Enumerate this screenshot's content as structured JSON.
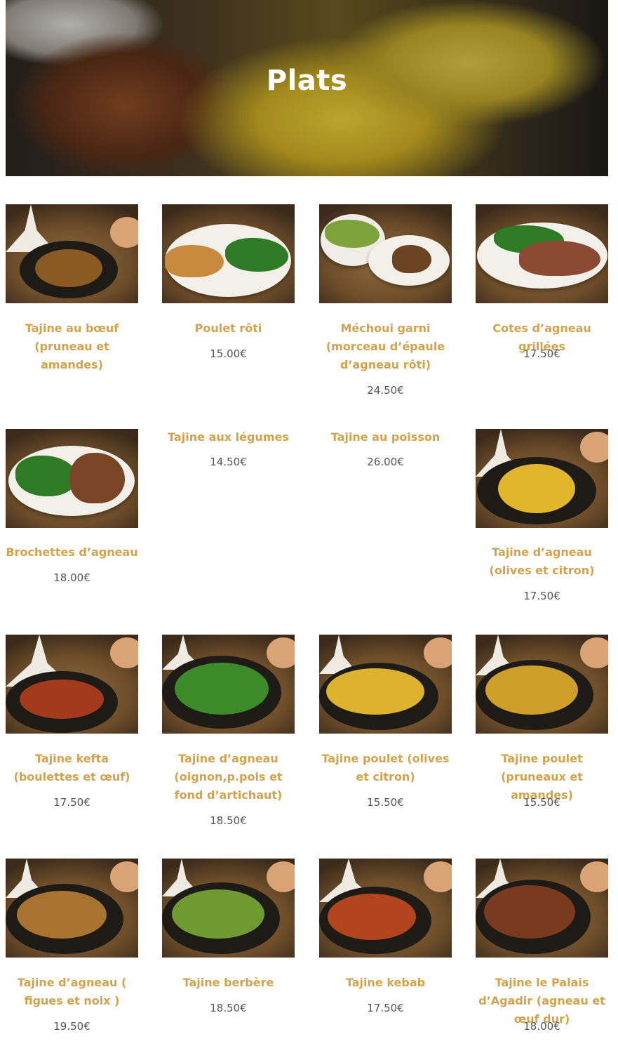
{
  "page": {
    "title": "Plats"
  },
  "dishes": [
    {
      "name": "Tajine au bœuf (pruneau et amandes)",
      "price": ""
    },
    {
      "name": "Poulet rôti",
      "price": "15.00€"
    },
    {
      "name": "Méchoui garni (morceau d’épaule d’agneau rôti)",
      "price": "24.50€"
    },
    {
      "name": "Cotes d’agneau grillées",
      "price": "17.50€"
    },
    {
      "name": "Brochettes d’agneau",
      "price": "18.00€"
    },
    {
      "name": "Tajine aux légumes",
      "price": "14.50€"
    },
    {
      "name": "Tajine au poisson",
      "price": "26.00€"
    },
    {
      "name": "Tajine d’agneau (olives et citron)",
      "price": "17.50€"
    },
    {
      "name": "Tajine kefta (boulettes et œuf)",
      "price": "17.50€"
    },
    {
      "name": "Tajine d’agneau (oignon,p.pois et fond d’artichaut)",
      "price": "18.50€"
    },
    {
      "name": "Tajine poulet (olives et citron)",
      "price": "15.50€"
    },
    {
      "name": "Tajine poulet (pruneaux et amandes)",
      "price": "15.50€"
    },
    {
      "name": "Tajine d’agneau ( figues et noix )",
      "price": "19.50€"
    },
    {
      "name": "Tajine berbère",
      "price": "18.50€"
    },
    {
      "name": "Tajine kebab",
      "price": "17.50€"
    },
    {
      "name": "Tajine le Palais d’Agadir (agneau et œuf dur)",
      "price": "18.00€"
    }
  ]
}
